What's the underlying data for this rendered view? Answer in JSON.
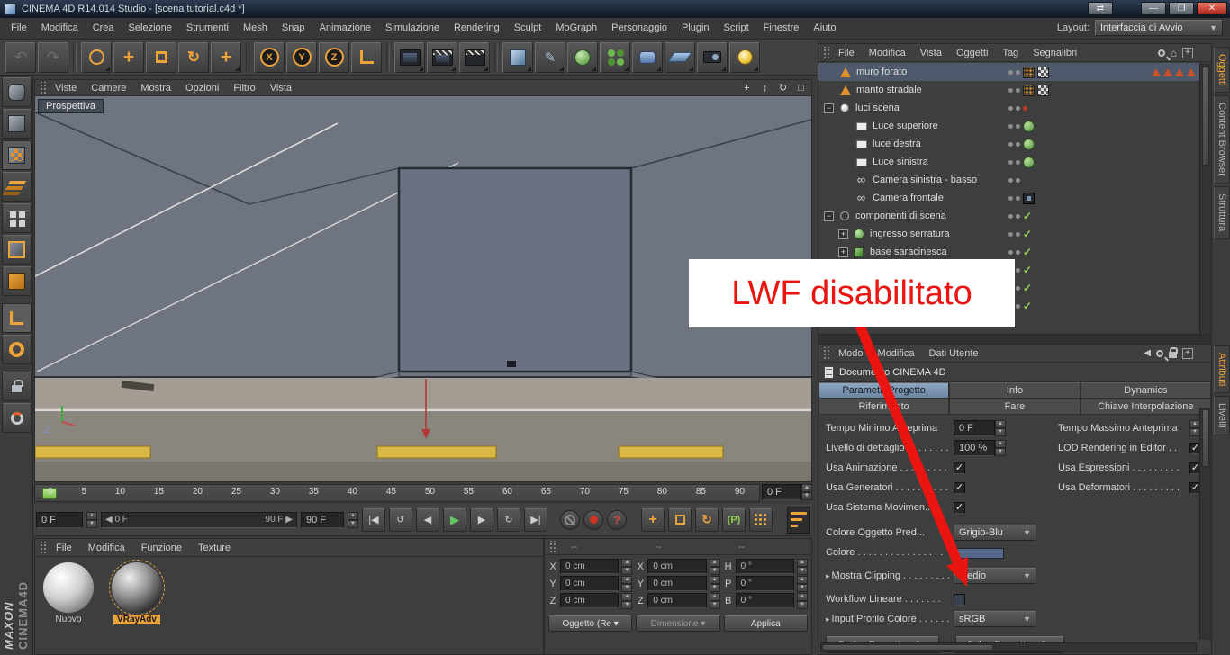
{
  "window": {
    "title": "CINEMA 4D R14.014 Studio - [scena tutorial.c4d *]"
  },
  "menubar": {
    "items": [
      "File",
      "Modifica",
      "Crea",
      "Selezione",
      "Strumenti",
      "Mesh",
      "Snap",
      "Animazione",
      "Simulazione",
      "Rendering",
      "Sculpt",
      "MoGraph",
      "Personaggio",
      "Plugin",
      "Script",
      "Finestre",
      "Aiuto"
    ],
    "layout_label": "Layout:",
    "layout_value": "Interfaccia di Avvio"
  },
  "viewport": {
    "menu": [
      "Viste",
      "Camere",
      "Mostra",
      "Opzioni",
      "Filtro",
      "Vista"
    ],
    "label": "Prospettiva"
  },
  "timeline": {
    "ticks": [
      "0",
      "5",
      "10",
      "15",
      "20",
      "25",
      "30",
      "35",
      "40",
      "45",
      "50",
      "55",
      "60",
      "65",
      "70",
      "75",
      "80",
      "85",
      "90"
    ],
    "frame_box": "0 F"
  },
  "transport": {
    "current_frame": "0 F",
    "range_start": "0 F",
    "range_end": "90 F",
    "end_frame": "90 F"
  },
  "materials": {
    "menu": [
      "File",
      "Modifica",
      "Funzione",
      "Texture"
    ],
    "items": [
      {
        "label": "Nuovo"
      },
      {
        "label": "VRayAdv"
      }
    ]
  },
  "coords": {
    "grip_headers": [
      "--",
      "--",
      "--"
    ],
    "axis_labels": [
      "X",
      "Y",
      "Z"
    ],
    "rot_labels": [
      "H",
      "P",
      "B"
    ],
    "pos_values": [
      "0 cm",
      "0 cm",
      "0 cm"
    ],
    "size_values": [
      "0 cm",
      "0 cm",
      "0 cm"
    ],
    "rot_values": [
      "0 °",
      "0 °",
      "0 °"
    ],
    "mode_object": "Oggetto (Re",
    "mode_size": "Dimensione",
    "apply": "Applica"
  },
  "object_manager": {
    "menu": [
      "File",
      "Modifica",
      "Vista",
      "Oggetti",
      "Tag",
      "Segnalibri"
    ],
    "items": [
      {
        "label": "muro forato"
      },
      {
        "label": "manto stradale"
      },
      {
        "label": "luci scena"
      },
      {
        "label": "Luce superiore"
      },
      {
        "label": "luce destra"
      },
      {
        "label": "Luce sinistra"
      },
      {
        "label": "Camera sinistra - basso"
      },
      {
        "label": "Camera frontale"
      },
      {
        "label": "componenti di scena"
      },
      {
        "label": "ingresso serratura"
      },
      {
        "label": "base saracinesca"
      }
    ]
  },
  "attributes": {
    "menu_tabs": [
      "Modo",
      "Modifica",
      "Dati Utente"
    ],
    "doc_title": "Documento CINEMA 4D",
    "tabs_row1": [
      "Parametri Progetto",
      "Info",
      "Dynamics"
    ],
    "tabs_row2": [
      "Riferimento",
      "Fare",
      "Chiave Interpolazione"
    ],
    "fields": {
      "tempo_min_label": "Tempo Minimo Anteprima",
      "tempo_min_value": "0 F",
      "tempo_max_label": "Tempo Massimo Anteprima",
      "lod_label": "Livello di dettaglio . . . . . . . .",
      "lod_value": "100 %",
      "lod_render_label": "LOD Rendering in Editor . .",
      "usa_anim_label": "Usa Animazione . . . . . . . . .",
      "usa_espr_label": "Usa Espressioni . . . . . . . . .",
      "usa_gen_label": "Usa Generatori . . . . . . . . . .",
      "usa_def_label": "Usa Deformatori . . . . . . . . .",
      "usa_sist_label": "Usa Sistema Movimen...",
      "colore_oggetto_label": "Colore Oggetto Pred...",
      "colore_oggetto_value": "Grigio-Blu",
      "colore_label": "Colore . . . . . . . . . . . . . . . .",
      "clipping_label": "Mostra Clipping . . . . . . . . .",
      "clipping_value": "Medio",
      "workflow_label": "Workflow Lineare . . . . . . .",
      "profilo_label": "Input Profilo Colore . . . . . .",
      "profilo_value": "sRGB"
    },
    "buttons": {
      "load": "Carica Presettaggi...",
      "save": "Salva Presettaggi..."
    }
  },
  "right_tabs": {
    "top": [
      "Oggetti",
      "Content Browser",
      "Struttura"
    ],
    "bottom": [
      "Attributi",
      "Livelli"
    ]
  },
  "annotation": {
    "text": "LWF disabilitato"
  },
  "brand": {
    "line1": "MAXON",
    "line2": "CINEMA4D"
  },
  "colors": {
    "accent_orange": "#eda33b",
    "annotation_red": "#ea1511",
    "viewport_bg": "#6e7480",
    "selection_blue": "#4e596b"
  }
}
